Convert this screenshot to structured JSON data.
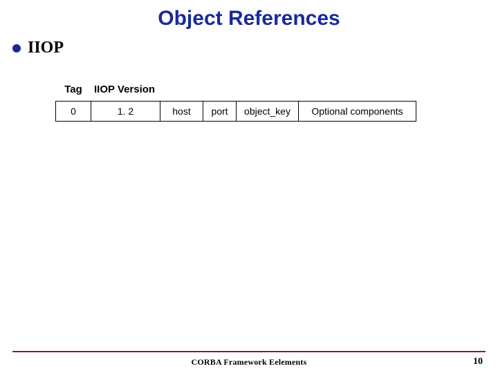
{
  "title": "Object References",
  "bullet": "IIOP",
  "table": {
    "headers": {
      "tag": "Tag",
      "version": "IIOP Version"
    },
    "row": {
      "tag": "0",
      "version": "1. 2",
      "host": "host",
      "port": "port",
      "object_key": "object_key",
      "optional": "Optional components"
    }
  },
  "footer": {
    "center": "CORBA Framework Eelements",
    "page": "10"
  }
}
